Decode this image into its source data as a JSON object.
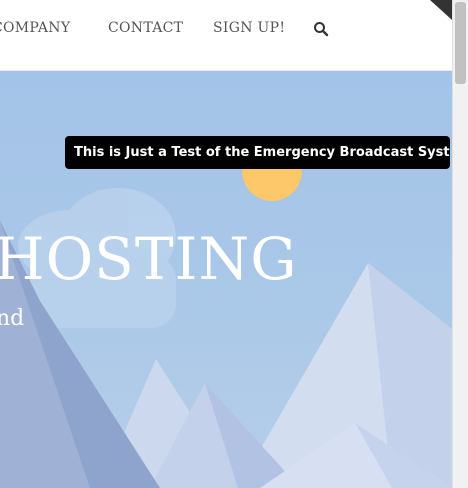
{
  "nav": {
    "company": "COMPANY",
    "contact": "CONTACT",
    "signup": "SIGN UP!",
    "search_icon": "search-icon"
  },
  "hero": {
    "title": "HOSTING",
    "subtitle": "nd"
  },
  "tooltip": {
    "text": "This is Just a Test of the Emergency Broadcast System"
  },
  "colors": {
    "sky": "#a3c3e8",
    "sun": "#fdc86a",
    "tooltip_bg": "#000000",
    "nav_text": "#555555"
  }
}
